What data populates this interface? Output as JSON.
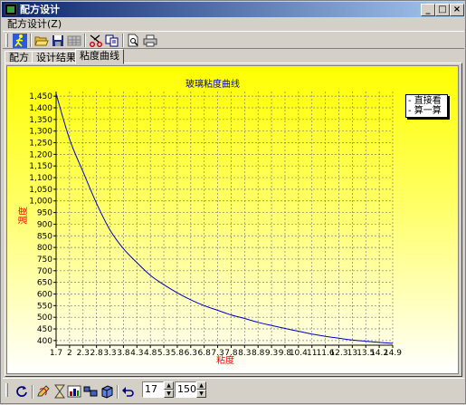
{
  "window": {
    "title": "配方设计",
    "minimize_label": "_",
    "maximize_label": "□",
    "close_label": "×"
  },
  "menu": {
    "items": [
      "配方设计(Z)"
    ]
  },
  "toolbar": {
    "icons": [
      "run-icon",
      "open-folder-icon",
      "save-icon",
      "grid-icon",
      "cut-icon",
      "copy-icon",
      "print-preview-icon",
      "print-icon"
    ]
  },
  "tabs": [
    {
      "label": "配方"
    },
    {
      "label": "设计结果"
    },
    {
      "label": "粘度曲线",
      "active": true
    }
  ],
  "legend": {
    "items": [
      "直接看",
      "算一算"
    ]
  },
  "bottom_toolbar": {
    "icons": [
      "refresh-icon",
      "edit-icon",
      "hourglass-icon",
      "chart-icon",
      "layout-icon",
      "cube-icon",
      "undo-icon"
    ],
    "spinner1_value": "17",
    "spinner2_value": "150"
  },
  "colors": {
    "chart_top": "#ffff00",
    "chart_bottom": "#ffffff",
    "curve": "#0000c0",
    "axis_label": "#ff0000",
    "title": "#0000c0"
  },
  "chart_data": {
    "type": "line",
    "title": "玻璃粘度曲线",
    "xlabel": "粘度",
    "ylabel": "温度",
    "x_tick_labels": [
      "1.7",
      "2",
      "2.3",
      "2.8",
      "3.3",
      "3.8",
      "4.3",
      "4.8",
      "5.3",
      "5.8",
      "6.3",
      "6.8",
      "7.3",
      "7.8",
      "8.3",
      "8.8",
      "9.3",
      "9.8",
      "10.4",
      "11",
      "11.6",
      "12.3",
      "13",
      "13.5",
      "14.2",
      "14.9"
    ],
    "xlim": [
      1.7,
      14.9
    ],
    "ylim": [
      380,
      1470
    ],
    "y_ticks": [
      400,
      450,
      500,
      550,
      600,
      650,
      700,
      750,
      800,
      850,
      900,
      950,
      1000,
      1050,
      1100,
      1150,
      1200,
      1250,
      1300,
      1350,
      1400,
      1450
    ],
    "grid": true,
    "legend_position": "top-right",
    "series": [
      {
        "x": [
          1.7,
          2.0,
          2.3,
          2.8,
          3.3,
          3.8,
          4.3,
          4.8,
          5.3,
          5.8,
          6.3,
          6.8,
          7.3,
          7.8,
          8.3,
          8.8,
          9.3,
          9.8,
          10.4,
          11.0,
          11.6,
          12.3,
          13.0,
          13.5,
          14.2,
          14.9
        ],
        "y": [
          1460,
          1265,
          1125,
          990,
          875,
          795,
          735,
          680,
          640,
          605,
          575,
          550,
          530,
          510,
          495,
          478,
          465,
          452,
          440,
          428,
          418,
          410,
          402,
          397,
          392,
          388
        ]
      }
    ]
  }
}
